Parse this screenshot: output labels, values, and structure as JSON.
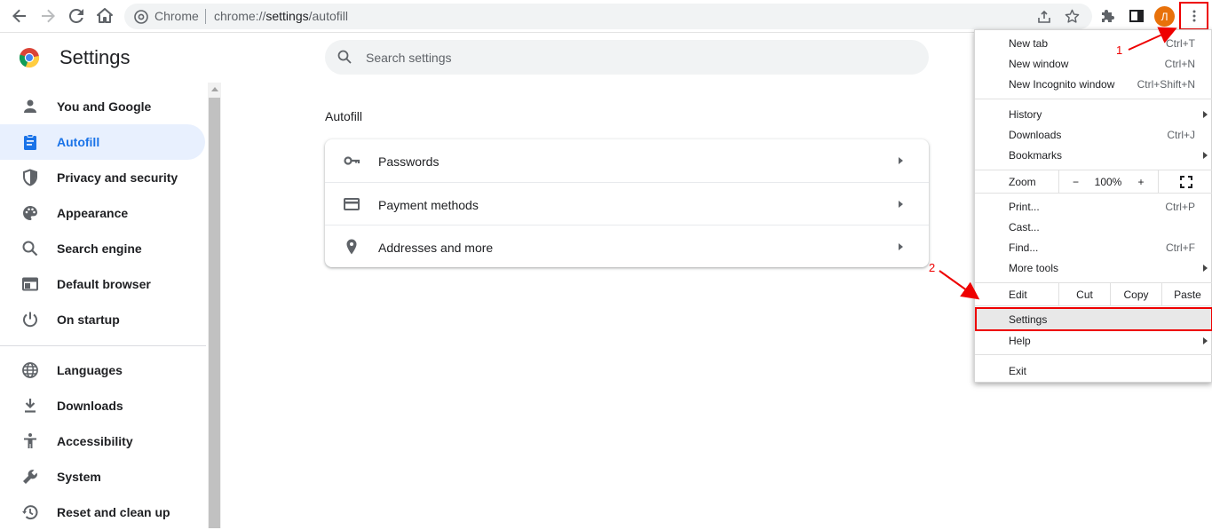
{
  "toolbar": {
    "omnibox_prefix": "Chrome",
    "url_scheme": "chrome://",
    "url_host": "settings",
    "url_path": "/autofill",
    "avatar_letter": "Л"
  },
  "header": {
    "title": "Settings",
    "search_placeholder": "Search settings"
  },
  "sidebar": {
    "items": [
      {
        "label": "You and Google",
        "icon": "person-icon",
        "active": false
      },
      {
        "label": "Autofill",
        "icon": "clipboard-icon",
        "active": true
      },
      {
        "label": "Privacy and security",
        "icon": "shield-icon",
        "active": false
      },
      {
        "label": "Appearance",
        "icon": "palette-icon",
        "active": false
      },
      {
        "label": "Search engine",
        "icon": "search-icon",
        "active": false
      },
      {
        "label": "Default browser",
        "icon": "browser-window-icon",
        "active": false
      },
      {
        "label": "On startup",
        "icon": "power-icon",
        "active": false
      },
      {
        "label": "Languages",
        "icon": "globe-icon",
        "active": false
      },
      {
        "label": "Downloads",
        "icon": "download-icon",
        "active": false
      },
      {
        "label": "Accessibility",
        "icon": "accessibility-icon",
        "active": false
      },
      {
        "label": "System",
        "icon": "wrench-icon",
        "active": false
      },
      {
        "label": "Reset and clean up",
        "icon": "history-icon",
        "active": false
      }
    ]
  },
  "main": {
    "section_title": "Autofill",
    "rows": [
      {
        "label": "Passwords",
        "icon": "key-icon"
      },
      {
        "label": "Payment methods",
        "icon": "credit-card-icon"
      },
      {
        "label": "Addresses and more",
        "icon": "location-pin-icon"
      }
    ]
  },
  "menu": {
    "new_tab": {
      "label": "New tab",
      "shortcut": "Ctrl+T"
    },
    "new_window": {
      "label": "New window",
      "shortcut": "Ctrl+N"
    },
    "new_incognito": {
      "label": "New Incognito window",
      "shortcut": "Ctrl+Shift+N"
    },
    "history": {
      "label": "History"
    },
    "downloads": {
      "label": "Downloads",
      "shortcut": "Ctrl+J"
    },
    "bookmarks": {
      "label": "Bookmarks"
    },
    "zoom": {
      "label": "Zoom",
      "minus": "−",
      "value": "100%",
      "plus": "+"
    },
    "print": {
      "label": "Print...",
      "shortcut": "Ctrl+P"
    },
    "cast": {
      "label": "Cast..."
    },
    "find": {
      "label": "Find...",
      "shortcut": "Ctrl+F"
    },
    "more_tools": {
      "label": "More tools"
    },
    "edit": {
      "label": "Edit",
      "cut": "Cut",
      "copy": "Copy",
      "paste": "Paste"
    },
    "settings": {
      "label": "Settings"
    },
    "help": {
      "label": "Help"
    },
    "exit": {
      "label": "Exit"
    }
  },
  "annotations": {
    "step1": "1",
    "step2": "2"
  },
  "colors": {
    "accent": "#1a73e8",
    "active_bg": "#e8f0fe",
    "highlight_red": "#e00",
    "avatar_bg": "#e8710a"
  }
}
